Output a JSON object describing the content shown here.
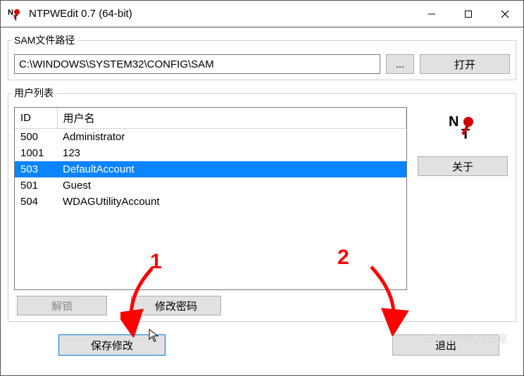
{
  "window": {
    "title": "NTPWEdit 0.7 (64-bit)"
  },
  "sam_group": {
    "legend": "SAM文件路径",
    "path_value": "C:\\WINDOWS\\SYSTEM32\\CONFIG\\SAM",
    "browse_label": "...",
    "open_label": "打开"
  },
  "userlist_group": {
    "legend": "用户列表",
    "col_id": "ID",
    "col_name": "用户名",
    "rows": [
      {
        "id": "500",
        "name": "Administrator",
        "selected": false
      },
      {
        "id": "1001",
        "name": "123",
        "selected": false
      },
      {
        "id": "503",
        "name": "DefaultAccount",
        "selected": true
      },
      {
        "id": "501",
        "name": "Guest",
        "selected": false
      },
      {
        "id": "504",
        "name": "WDAGUtilityAccount",
        "selected": false
      }
    ],
    "about_label": "关于",
    "unlock_label": "解锁",
    "changepw_label": "修改密码"
  },
  "bottom": {
    "save_label": "保存修改",
    "exit_label": "退出"
  },
  "annotations": {
    "num1": "1",
    "num2": "2",
    "watermark": "头条 @搞机作战室"
  }
}
